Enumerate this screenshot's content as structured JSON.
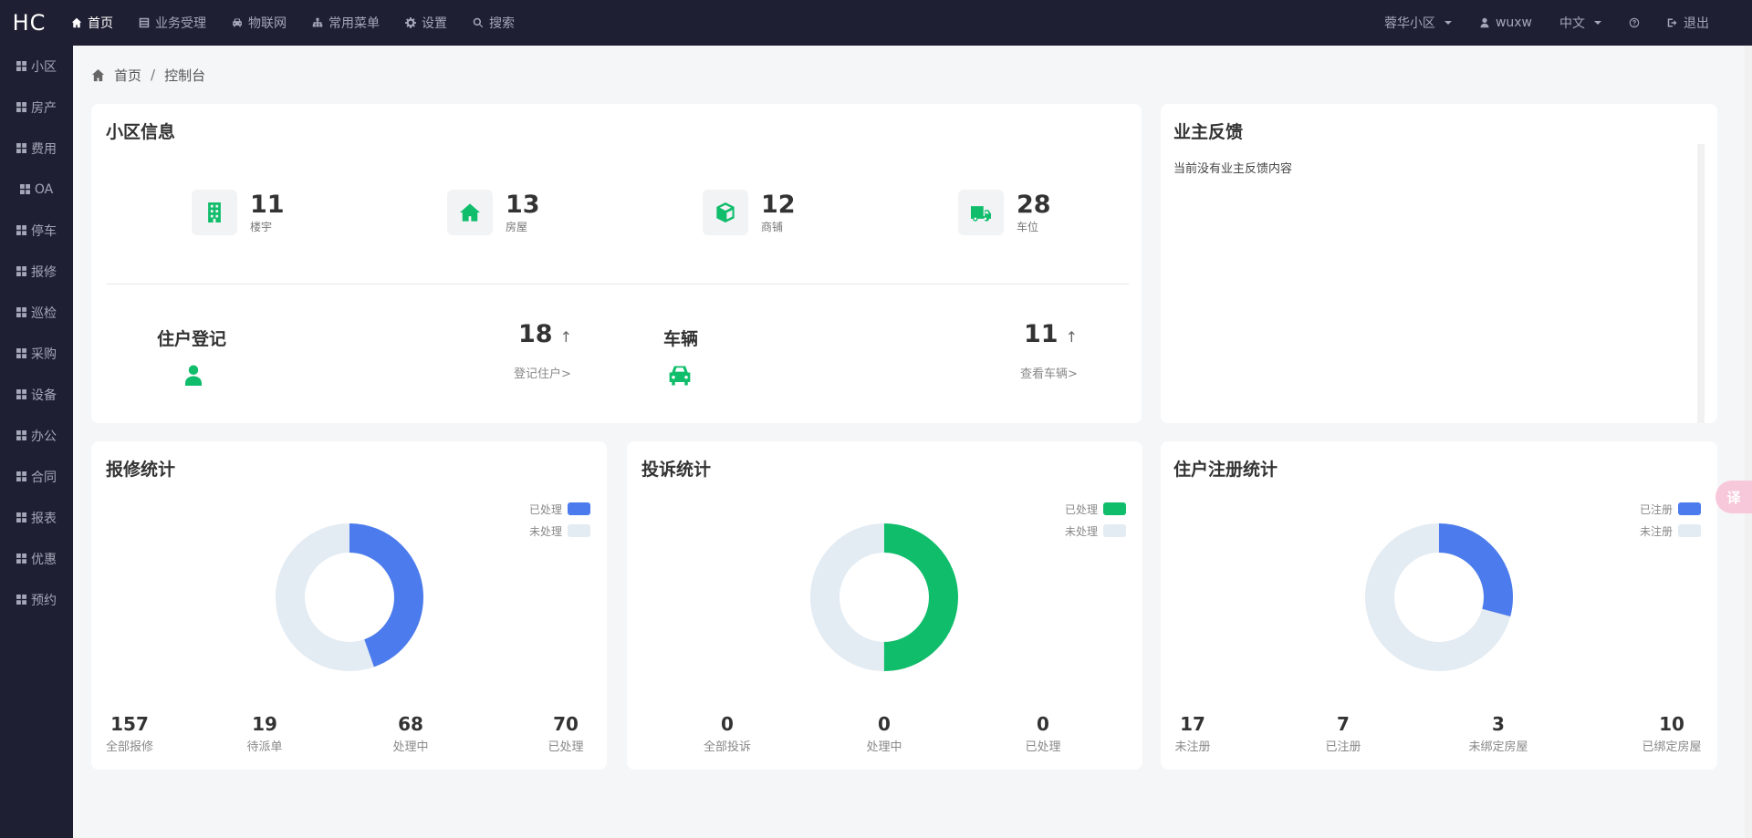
{
  "app": {
    "brand": "HC"
  },
  "topnav": [
    {
      "label": "首页",
      "icon": "home-icon",
      "active": true
    },
    {
      "label": "业务受理",
      "icon": "list-icon",
      "active": false
    },
    {
      "label": "物联网",
      "icon": "car-icon",
      "active": false
    },
    {
      "label": "常用菜单",
      "icon": "sitemap-icon",
      "active": false
    },
    {
      "label": "设置",
      "icon": "gear-icon",
      "active": false
    },
    {
      "label": "搜索",
      "icon": "search-icon",
      "active": false
    }
  ],
  "topright": {
    "community": "蓉华小区",
    "user": "wuxw",
    "language": "中文",
    "help_icon": "help-icon",
    "logout": "退出"
  },
  "sidebar": [
    {
      "label": "小区"
    },
    {
      "label": "房产"
    },
    {
      "label": "费用"
    },
    {
      "label": "OA"
    },
    {
      "label": "停车"
    },
    {
      "label": "报修"
    },
    {
      "label": "巡检"
    },
    {
      "label": "采购"
    },
    {
      "label": "设备"
    },
    {
      "label": "办公"
    },
    {
      "label": "合同"
    },
    {
      "label": "报表"
    },
    {
      "label": "优惠"
    },
    {
      "label": "预约"
    }
  ],
  "breadcrumb": {
    "home": "首页",
    "current": "控制台"
  },
  "community_info": {
    "title": "小区信息",
    "stats": [
      {
        "value": "11",
        "label": "楼宇",
        "icon": "building-icon"
      },
      {
        "value": "13",
        "label": "房屋",
        "icon": "house-icon"
      },
      {
        "value": "12",
        "label": "商铺",
        "icon": "cube-icon"
      },
      {
        "value": "28",
        "label": "车位",
        "icon": "truck-icon"
      }
    ],
    "resident": {
      "title": "住户登记",
      "value": "18",
      "up": "↑",
      "link": "登记住户>",
      "icon": "user-icon"
    },
    "vehicle": {
      "title": "车辆",
      "value": "11",
      "up": "↑",
      "link": "查看车辆>",
      "icon": "car-icon"
    }
  },
  "feedback": {
    "title": "业主反馈",
    "empty": "当前没有业主反馈内容"
  },
  "repair": {
    "title": "报修统计",
    "legend": [
      {
        "label": "已处理",
        "color": "#4b7bec"
      },
      {
        "label": "未处理",
        "color": "#e3ebf3"
      }
    ],
    "chart": {
      "done": 70,
      "total": 157
    },
    "stats": [
      {
        "value": "157",
        "label": "全部报修"
      },
      {
        "value": "19",
        "label": "待派单"
      },
      {
        "value": "68",
        "label": "处理中"
      },
      {
        "value": "70",
        "label": "已处理"
      }
    ]
  },
  "complaint": {
    "title": "投诉统计",
    "legend": [
      {
        "label": "已处理",
        "color": "#0fbd6b"
      },
      {
        "label": "未处理",
        "color": "#e3ebf3"
      }
    ],
    "chart": {
      "done": 1,
      "total": 2
    },
    "stats": [
      {
        "value": "0",
        "label": "全部投诉"
      },
      {
        "value": "0",
        "label": "处理中"
      },
      {
        "value": "0",
        "label": "已处理"
      }
    ]
  },
  "registration": {
    "title": "住户注册统计",
    "legend": [
      {
        "label": "已注册",
        "color": "#4b7bec"
      },
      {
        "label": "未注册",
        "color": "#e3ebf3"
      }
    ],
    "chart": {
      "done": 7,
      "total": 24
    },
    "stats": [
      {
        "value": "17",
        "label": "未注册"
      },
      {
        "value": "7",
        "label": "已注册"
      },
      {
        "value": "3",
        "label": "未绑定房屋"
      },
      {
        "value": "10",
        "label": "已绑定房屋"
      }
    ]
  },
  "float_button": "译"
}
